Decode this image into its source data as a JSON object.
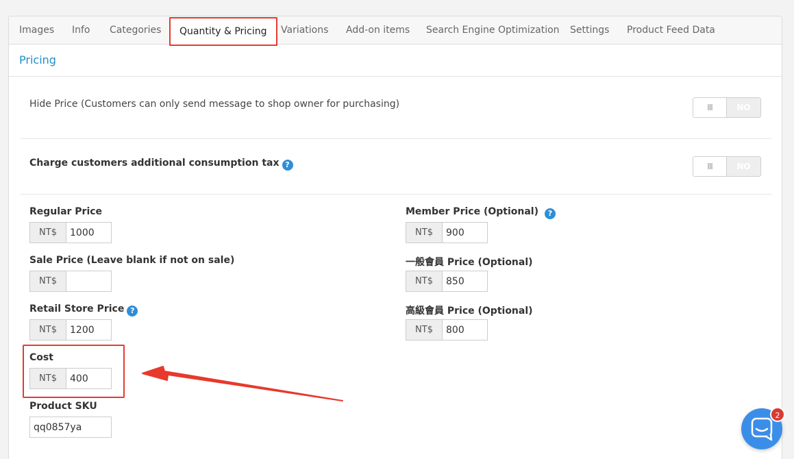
{
  "tabs": [
    {
      "label": "Images"
    },
    {
      "label": "Info"
    },
    {
      "label": "Categories"
    },
    {
      "label": "Quantity & Pricing",
      "active": true
    },
    {
      "label": "Variations"
    },
    {
      "label": "Add-on items"
    },
    {
      "label": "Search Engine Optimization"
    },
    {
      "label": "Settings"
    },
    {
      "label": "Product Feed Data"
    }
  ],
  "section_title": "Pricing",
  "hide_price": {
    "label": "Hide Price (Customers can only send message to shop owner for purchasing)",
    "toggle_handle": "III",
    "toggle_value": "NO"
  },
  "consumption_tax": {
    "label": "Charge customers additional consumption tax",
    "help": "?",
    "toggle_handle": "III",
    "toggle_value": "NO"
  },
  "currency": "NT$",
  "fields": {
    "regular_price": {
      "label": "Regular Price",
      "value": "1000"
    },
    "sale_price": {
      "label": "Sale Price (Leave blank if not on sale)",
      "value": ""
    },
    "retail_store_price": {
      "label": "Retail Store Price",
      "value": "1200",
      "help": "?"
    },
    "cost": {
      "label": "Cost",
      "value": "400"
    },
    "product_sku": {
      "label": "Product SKU",
      "value": "qq0857ya"
    },
    "member_price": {
      "label": "Member Price (Optional)",
      "value": "900",
      "help": "?"
    },
    "general_member_price": {
      "label": "一般會員 Price (Optional)",
      "value": "850"
    },
    "premium_member_price": {
      "label": "高級會員 Price (Optional)",
      "value": "800"
    }
  },
  "chat": {
    "badge_count": "2",
    "icon": "chat-bubble-icon"
  },
  "colors": {
    "accent": "#1f8fc9",
    "highlight": "#e8392c",
    "help": "#2e8ed8",
    "chat": "#3b8ee8",
    "badge": "#d93a32"
  }
}
